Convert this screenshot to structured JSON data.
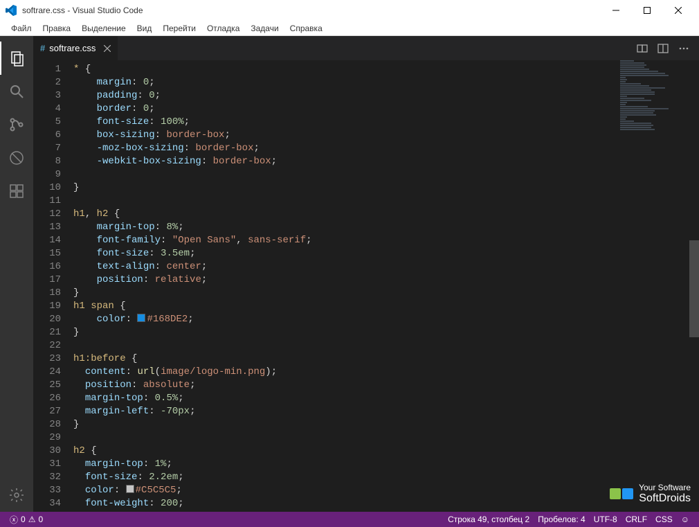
{
  "window": {
    "title": "softrare.css - Visual Studio Code"
  },
  "menu": [
    "Файл",
    "Правка",
    "Выделение",
    "Вид",
    "Перейти",
    "Отладка",
    "Задачи",
    "Справка"
  ],
  "activity": {
    "items": [
      "explorer",
      "search",
      "git",
      "debug",
      "extensions"
    ],
    "bottom": [
      "settings"
    ]
  },
  "tab": {
    "file_icon": "#",
    "filename": "softrare.css"
  },
  "code": {
    "start_line": 1,
    "lines": [
      [
        [
          "sel",
          "* "
        ],
        [
          "punc",
          "{"
        ]
      ],
      [
        [
          "indent",
          4
        ],
        [
          "prop",
          "margin"
        ],
        [
          "punc",
          ": "
        ],
        [
          "num",
          "0"
        ],
        [
          "punc",
          ";"
        ]
      ],
      [
        [
          "indent",
          4
        ],
        [
          "prop",
          "padding"
        ],
        [
          "punc",
          ": "
        ],
        [
          "num",
          "0"
        ],
        [
          "punc",
          ";"
        ]
      ],
      [
        [
          "indent",
          4
        ],
        [
          "prop",
          "border"
        ],
        [
          "punc",
          ": "
        ],
        [
          "num",
          "0"
        ],
        [
          "punc",
          ";"
        ]
      ],
      [
        [
          "indent",
          4
        ],
        [
          "prop",
          "font-size"
        ],
        [
          "punc",
          ": "
        ],
        [
          "num",
          "100%"
        ],
        [
          "punc",
          ";"
        ]
      ],
      [
        [
          "indent",
          4
        ],
        [
          "prop",
          "box-sizing"
        ],
        [
          "punc",
          ": "
        ],
        [
          "val",
          "border-box"
        ],
        [
          "punc",
          ";"
        ]
      ],
      [
        [
          "indent",
          4
        ],
        [
          "prop",
          "-moz-box-sizing"
        ],
        [
          "punc",
          ": "
        ],
        [
          "val",
          "border-box"
        ],
        [
          "punc",
          ";"
        ]
      ],
      [
        [
          "indent",
          4
        ],
        [
          "prop",
          "-webkit-box-sizing"
        ],
        [
          "punc",
          ": "
        ],
        [
          "val",
          "border-box"
        ],
        [
          "punc",
          ";"
        ]
      ],
      [],
      [
        [
          "punc",
          "}"
        ]
      ],
      [],
      [
        [
          "sel",
          "h1"
        ],
        [
          "punc",
          ", "
        ],
        [
          "sel",
          "h2 "
        ],
        [
          "punc",
          "{"
        ]
      ],
      [
        [
          "indent",
          4
        ],
        [
          "prop",
          "margin-top"
        ],
        [
          "punc",
          ": "
        ],
        [
          "num",
          "8%"
        ],
        [
          "punc",
          ";"
        ]
      ],
      [
        [
          "indent",
          4
        ],
        [
          "prop",
          "font-family"
        ],
        [
          "punc",
          ": "
        ],
        [
          "str",
          "\"Open Sans\""
        ],
        [
          "punc",
          ", "
        ],
        [
          "val",
          "sans-serif"
        ],
        [
          "punc",
          ";"
        ]
      ],
      [
        [
          "indent",
          4
        ],
        [
          "prop",
          "font-size"
        ],
        [
          "punc",
          ": "
        ],
        [
          "num",
          "3.5em"
        ],
        [
          "punc",
          ";"
        ]
      ],
      [
        [
          "indent",
          4
        ],
        [
          "prop",
          "text-align"
        ],
        [
          "punc",
          ": "
        ],
        [
          "val",
          "center"
        ],
        [
          "punc",
          ";"
        ]
      ],
      [
        [
          "indent",
          4
        ],
        [
          "prop",
          "position"
        ],
        [
          "punc",
          ": "
        ],
        [
          "val",
          "relative"
        ],
        [
          "punc",
          ";"
        ]
      ],
      [
        [
          "punc",
          "}"
        ]
      ],
      [
        [
          "sel",
          "h1 span "
        ],
        [
          "punc",
          "{"
        ]
      ],
      [
        [
          "indent",
          4
        ],
        [
          "prop",
          "color"
        ],
        [
          "punc",
          ": "
        ],
        [
          "swatch",
          "#168DE2"
        ],
        [
          "val",
          "#168DE2"
        ],
        [
          "punc",
          ";"
        ]
      ],
      [
        [
          "punc",
          "}"
        ]
      ],
      [],
      [
        [
          "sel",
          "h1:before "
        ],
        [
          "punc",
          "{"
        ]
      ],
      [
        [
          "indent",
          2
        ],
        [
          "prop",
          "content"
        ],
        [
          "punc",
          ": "
        ],
        [
          "func",
          "url"
        ],
        [
          "punc",
          "("
        ],
        [
          "val",
          "image/logo-min.png"
        ],
        [
          "punc",
          ");"
        ]
      ],
      [
        [
          "indent",
          2
        ],
        [
          "prop",
          "position"
        ],
        [
          "punc",
          ": "
        ],
        [
          "val",
          "absolute"
        ],
        [
          "punc",
          ";"
        ]
      ],
      [
        [
          "indent",
          2
        ],
        [
          "prop",
          "margin-top"
        ],
        [
          "punc",
          ": "
        ],
        [
          "num",
          "0.5%"
        ],
        [
          "punc",
          ";"
        ]
      ],
      [
        [
          "indent",
          2
        ],
        [
          "prop",
          "margin-left"
        ],
        [
          "punc",
          ": "
        ],
        [
          "num",
          "-70px"
        ],
        [
          "punc",
          ";"
        ]
      ],
      [
        [
          "punc",
          "}"
        ]
      ],
      [],
      [
        [
          "sel",
          "h2 "
        ],
        [
          "punc",
          "{"
        ]
      ],
      [
        [
          "indent",
          2
        ],
        [
          "prop",
          "margin-top"
        ],
        [
          "punc",
          ": "
        ],
        [
          "num",
          "1%"
        ],
        [
          "punc",
          ";"
        ]
      ],
      [
        [
          "indent",
          2
        ],
        [
          "prop",
          "font-size"
        ],
        [
          "punc",
          ": "
        ],
        [
          "num",
          "2.2em"
        ],
        [
          "punc",
          ";"
        ]
      ],
      [
        [
          "indent",
          2
        ],
        [
          "prop",
          "color"
        ],
        [
          "punc",
          ": "
        ],
        [
          "swatch",
          "#C5C5C5"
        ],
        [
          "val",
          "#C5C5C5"
        ],
        [
          "punc",
          ";"
        ]
      ],
      [
        [
          "indent",
          2
        ],
        [
          "prop",
          "font-weight"
        ],
        [
          "punc",
          ": "
        ],
        [
          "num",
          "200"
        ],
        [
          "punc",
          ";"
        ]
      ]
    ]
  },
  "status": {
    "errors_icon": "ⓧ",
    "errors": "0",
    "warnings_icon": "⚠",
    "warnings": "0",
    "cursor": "Строка 49, столбец 2",
    "spaces": "Пробелов: 4",
    "encoding": "UTF-8",
    "eol": "CRLF",
    "lang": "CSS",
    "smiley": "☺"
  },
  "watermark": {
    "line1": "Your Software",
    "line2": "SoftDroids"
  }
}
